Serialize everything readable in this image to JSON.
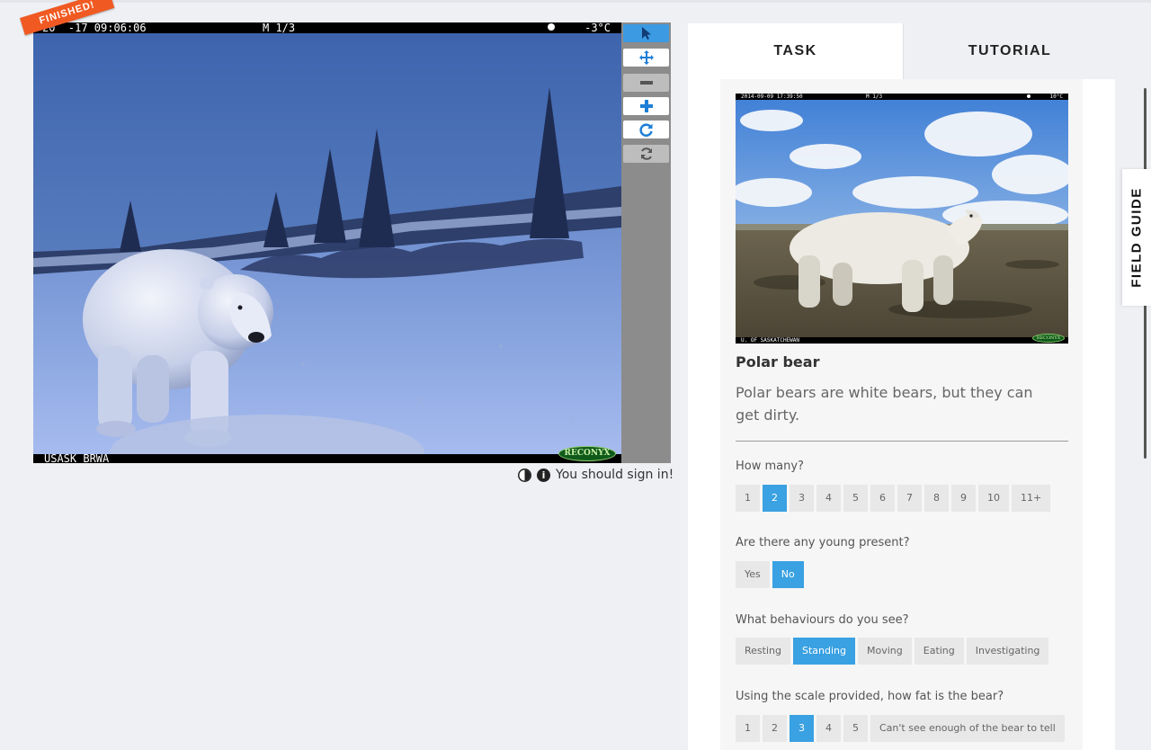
{
  "subject": {
    "camera_timestamp": "20  -17 09:06:06",
    "camera_mode": "M 1/3",
    "camera_temp": "-3°C",
    "camera_location": "USASK BRWA",
    "camera_brand": "RECONYX",
    "status_ribbon": "FINISHED!"
  },
  "toolbar": [
    {
      "name": "annotate-tool",
      "icon": "pointer-icon",
      "state": "active"
    },
    {
      "name": "move-tool",
      "icon": "move-icon",
      "state": "normal"
    },
    {
      "name": "zoom-out-tool",
      "icon": "minus-icon",
      "state": "disabled"
    },
    {
      "name": "zoom-in-tool",
      "icon": "plus-icon",
      "state": "normal"
    },
    {
      "name": "rotate-tool",
      "icon": "rotate-icon",
      "state": "normal"
    },
    {
      "name": "reset-tool",
      "icon": "refresh-icon",
      "state": "disabled"
    }
  ],
  "viewer_footer": {
    "sign_in_text": "You should sign in!",
    "info_glyph": "i"
  },
  "tabs": {
    "task": "TASK",
    "tutorial": "TUTORIAL"
  },
  "field_guide": "FIELD GUIDE",
  "example": {
    "camera_timestamp": "2014-09-09 17:39:50",
    "camera_mode": "M 1/3",
    "camera_temp": "10°C",
    "camera_location": "U. OF SASKATCHEWAN",
    "camera_brand": "RECONYX"
  },
  "species": {
    "name": "Polar bear",
    "description": "Polar bears are white bears, but they can get dirty."
  },
  "questions": [
    {
      "label": "How many?",
      "options": [
        "1",
        "2",
        "3",
        "4",
        "5",
        "6",
        "7",
        "8",
        "9",
        "10",
        "11+"
      ],
      "selected": 1
    },
    {
      "label": "Are there any young present?",
      "options": [
        "Yes",
        "No"
      ],
      "selected": 1
    },
    {
      "label": "What behaviours do you see?",
      "options": [
        "Resting",
        "Standing",
        "Moving",
        "Eating",
        "Investigating"
      ],
      "selected": 1
    },
    {
      "label": "Using the scale provided, how fat is the bear?",
      "options": [
        "1",
        "2",
        "3",
        "4",
        "5",
        "Can't see enough of the bear to tell"
      ],
      "selected": 2
    }
  ],
  "colors": {
    "accent": "#3aa1e2",
    "tool_active": "#3b9ae1",
    "ribbon": "#f05a22"
  }
}
